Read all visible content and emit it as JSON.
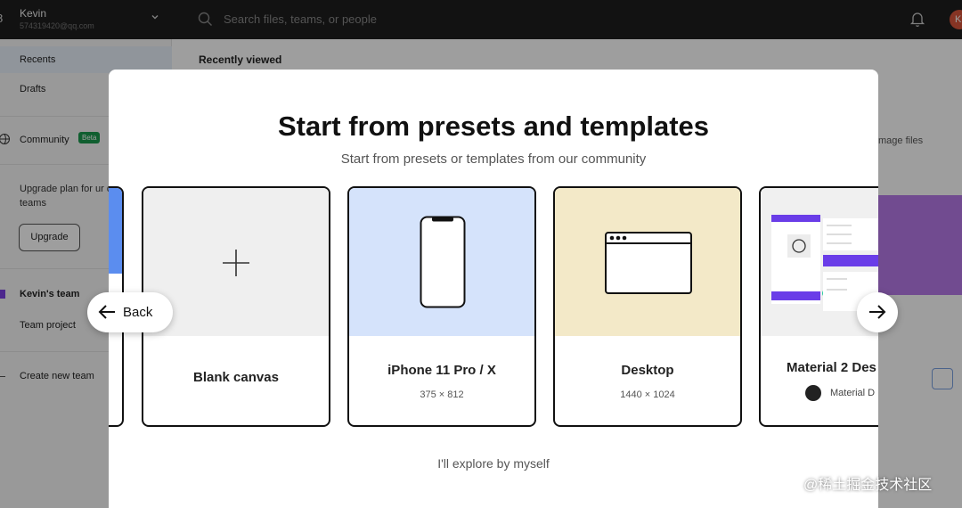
{
  "account": {
    "name": "Kevin",
    "email": "574319420@qq.com"
  },
  "search": {
    "placeholder": "Search files, teams, or people"
  },
  "avatar_letter": "K",
  "sidebar": {
    "recents": "Recents",
    "drafts": "Drafts",
    "community": "Community",
    "beta": "Beta",
    "upgrade_text": "Upgrade plan for ur design files in teams",
    "upgrade_button": "Upgrade",
    "team_name": "Kevin's team",
    "team_project": "Team project",
    "create_team": "Create new team"
  },
  "main": {
    "recently_viewed": "Recently viewed",
    "import_hint": "mage files"
  },
  "modal": {
    "title": "Start from presets and templates",
    "subtitle": "Start from presets or templates from our community",
    "back_label": "Back",
    "explore_label": "I'll explore by myself",
    "cards": [
      {
        "name": "Blank canvas",
        "size": ""
      },
      {
        "name": "iPhone 11 Pro / X",
        "size": "375 × 812"
      },
      {
        "name": "Desktop",
        "size": "1440 × 1024"
      },
      {
        "name": "Material 2 Des",
        "author": "Material D"
      }
    ]
  },
  "watermark": "@稀土掘金技术社区",
  "colors": {
    "accent": "#7b3fe4",
    "iphone_bg": "#d5e3fb",
    "desktop_bg": "#f3e9c8",
    "blank_bg": "#efefef"
  }
}
